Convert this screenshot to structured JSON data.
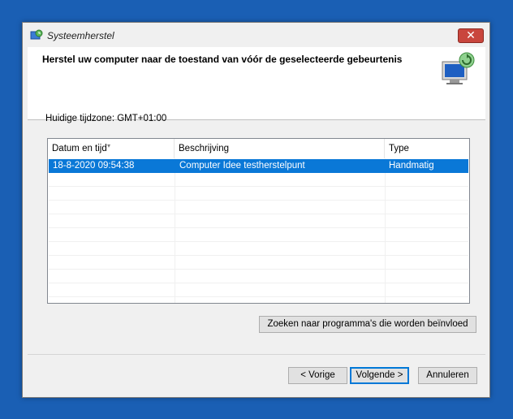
{
  "window": {
    "title": "Systeemherstel",
    "close_glyph": "✕",
    "header_heading": "Herstel uw computer naar de toestand van vóór de geselecteerde gebeurtenis"
  },
  "timezone_label": "Huidige tijdzone: GMT+01:00",
  "list": {
    "columns": [
      "Datum en tijd",
      "Beschrijving",
      "Type"
    ],
    "sort_indicator": "▾",
    "rows": [
      {
        "date": "18-8-2020 09:54:38",
        "description": "Computer Idee testherstelpunt",
        "type": "Handmatig",
        "selected": true
      }
    ]
  },
  "buttons": {
    "scan_affected": "Zoeken naar programma's die worden beïnvloed",
    "back": "< Vorige",
    "next": "Volgende >",
    "cancel": "Annuleren"
  },
  "colors": {
    "selection": "#0a78d7",
    "desktop": "#1a5fb4",
    "close_button": "#c9463d"
  },
  "icons": {
    "app": "system-restore-icon",
    "banner": "system-restore-monitor-icon"
  }
}
